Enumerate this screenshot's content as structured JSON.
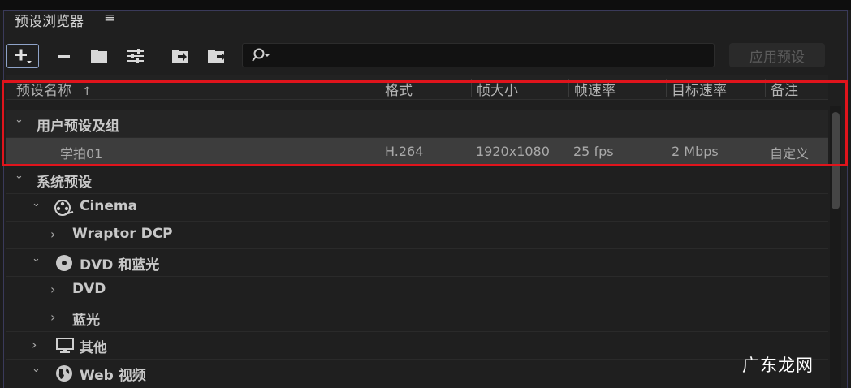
{
  "panel": {
    "title": "预设浏览器",
    "menu_icon": "≡"
  },
  "toolbar": {
    "add_icon": "plus-icon",
    "remove_icon": "minus-icon",
    "search_placeholder": "",
    "apply_label": "应用预设"
  },
  "columns": {
    "name": "预设名称",
    "sort_arrow": "↑",
    "format": "格式",
    "frame_size": "帧大小",
    "frame_rate": "帧速率",
    "target_rate": "目标速率",
    "notes": "备注"
  },
  "rows": {
    "user_group": {
      "chevron": "⌄",
      "label": "用户预设及组"
    },
    "user_preset": {
      "name": "学拍01",
      "format": "H.264",
      "frame_size": "1920x1080",
      "frame_rate": "25 fps",
      "target_rate": "2 Mbps",
      "notes": "自定义"
    },
    "system": {
      "chevron": "⌄",
      "label": "系统预设"
    },
    "cinema": {
      "chevron": "⌄",
      "label": "Cinema"
    },
    "wraptor": {
      "chevron": "›",
      "label": "Wraptor DCP"
    },
    "dvd_bluray": {
      "chevron": "⌄",
      "label": "DVD 和蓝光"
    },
    "dvd": {
      "chevron": "›",
      "label": "DVD"
    },
    "bluray": {
      "chevron": "›",
      "label": "蓝光"
    },
    "other": {
      "chevron": "›",
      "label": "其他"
    },
    "web": {
      "chevron": "⌄",
      "label": "Web 视频"
    }
  },
  "watermark": "广东龙网"
}
